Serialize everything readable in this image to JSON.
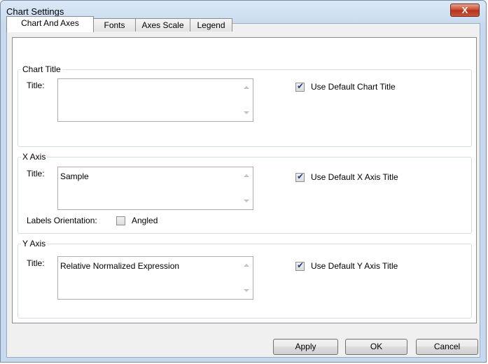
{
  "window": {
    "title": "Chart Settings",
    "close_glyph": "X"
  },
  "tabs": [
    {
      "label": "Chart And Axes",
      "active": true
    },
    {
      "label": "Fonts",
      "active": false
    },
    {
      "label": "Axes Scale",
      "active": false
    },
    {
      "label": "Legend",
      "active": false
    }
  ],
  "chart_title": {
    "group_label": "Chart Title",
    "title_label": "Title:",
    "title_value": "",
    "use_default_label": "Use Default Chart Title",
    "use_default_checked": true
  },
  "x_axis": {
    "group_label": "X Axis",
    "title_label": "Title:",
    "title_value": "Sample",
    "use_default_label": "Use Default X Axis Title",
    "use_default_checked": true,
    "labels_orientation_label": "Labels Orientation:",
    "angled_label": "Angled",
    "angled_checked": false
  },
  "y_axis": {
    "group_label": "Y Axis",
    "title_label": "Title:",
    "title_value": "Relative Normalized Expression",
    "use_default_label": "Use Default Y Axis Title",
    "use_default_checked": true
  },
  "buttons": {
    "apply": "Apply",
    "ok": "OK",
    "cancel": "Cancel"
  }
}
